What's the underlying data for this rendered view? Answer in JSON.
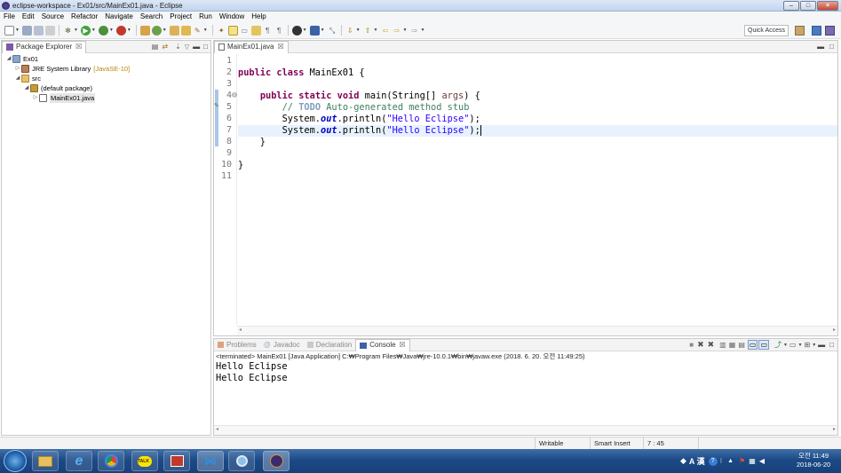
{
  "window": {
    "title": "eclipse-workspace - Ex01/src/MainEx01.java - Eclipse",
    "min": "–",
    "max": "□",
    "close": "×"
  },
  "menu": [
    "File",
    "Edit",
    "Source",
    "Refactor",
    "Navigate",
    "Search",
    "Project",
    "Run",
    "Window",
    "Help"
  ],
  "toolbar": {
    "quick_access": "Quick Access"
  },
  "package_explorer": {
    "tab_label": "Package Explorer",
    "tab_close": "☒",
    "tree": [
      {
        "label": "Ex01",
        "suffix": ""
      },
      {
        "label": "JRE System Library",
        "suffix": "[JavaSE-10]"
      },
      {
        "label": "src",
        "suffix": ""
      },
      {
        "label": "(default package)",
        "suffix": ""
      },
      {
        "label": "MainEx01.java",
        "suffix": ""
      }
    ]
  },
  "editor": {
    "tab_label": "MainEx01.java",
    "tab_close": "☒",
    "line_numbers": [
      "1",
      "2",
      "3",
      "4⊖",
      "5",
      "6",
      "7",
      "8",
      "9",
      "10",
      "11"
    ]
  },
  "bottom_tabs": {
    "problems": "Problems",
    "javadoc": "Javadoc",
    "declaration": "Declaration",
    "console": "Console",
    "console_close": "☒"
  },
  "console": {
    "header": "<terminated> MainEx01 [Java Application] C:₩Program Files₩Java₩jre-10.0.1₩bin₩javaw.exe (2018. 6. 20. 오전 11:49:25)",
    "output": [
      "Hello Eclipse",
      "Hello Eclipse"
    ]
  },
  "status": {
    "writable": "Writable",
    "insert_mode": "Smart Insert",
    "position": "7 : 45"
  },
  "taskbar": {
    "ime": "A 漢",
    "time": "오전 11:49",
    "date": "2018-06-20"
  }
}
